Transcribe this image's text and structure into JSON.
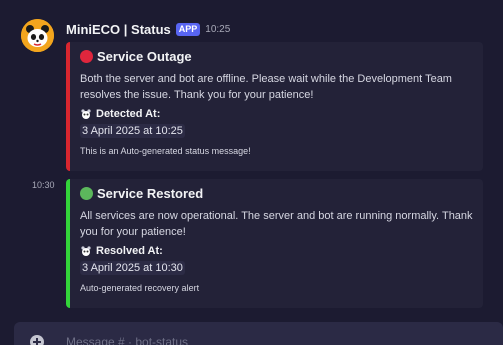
{
  "message": {
    "author": "MiniECO | Status",
    "badge": "APP",
    "time": "10:25"
  },
  "outage_embed": {
    "title": "Service Outage",
    "description": "Both the server and bot are offline. Please wait while the Development Team resolves the issue. Thank you for your patience!",
    "field_name": "Detected At:",
    "field_value": "3 April 2025 at 10:25",
    "footer": "This is an Auto-generated status message!",
    "accent_color": "#d8262f"
  },
  "restored_message": {
    "time": "10:30"
  },
  "restored_embed": {
    "title": "Service Restored",
    "description": "All services are now operational. The server and bot are running normally. Thank you for your patience!",
    "field_name": "Resolved At:",
    "field_value": "3 April 2025 at 10:30",
    "footer": "Auto-generated recovery alert",
    "accent_color": "#33d43a"
  },
  "composer": {
    "placeholder": "Message # · bot-status"
  },
  "icons": {
    "avatar": "panda-avatar-icon",
    "outage_status": "red-circle-icon",
    "restored_status": "green-circle-icon",
    "field": "panda-icon"
  }
}
